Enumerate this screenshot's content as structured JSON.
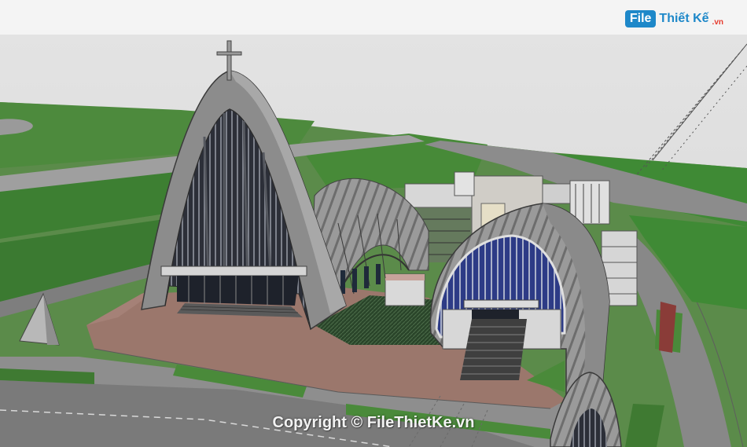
{
  "logo": {
    "badge": "File",
    "name": "Thiết Kế",
    "suffix": ".vn"
  },
  "watermark": "Copyright © FileThietKe.vn",
  "colors": {
    "sky": "#e2e2e2",
    "lawn": "#3e7f32",
    "road": "#8d8d8d",
    "plaza": "#9a786d",
    "concrete": "#8f8f8f",
    "glass": "#2f3e8a"
  },
  "icons": [
    "cross-icon"
  ]
}
